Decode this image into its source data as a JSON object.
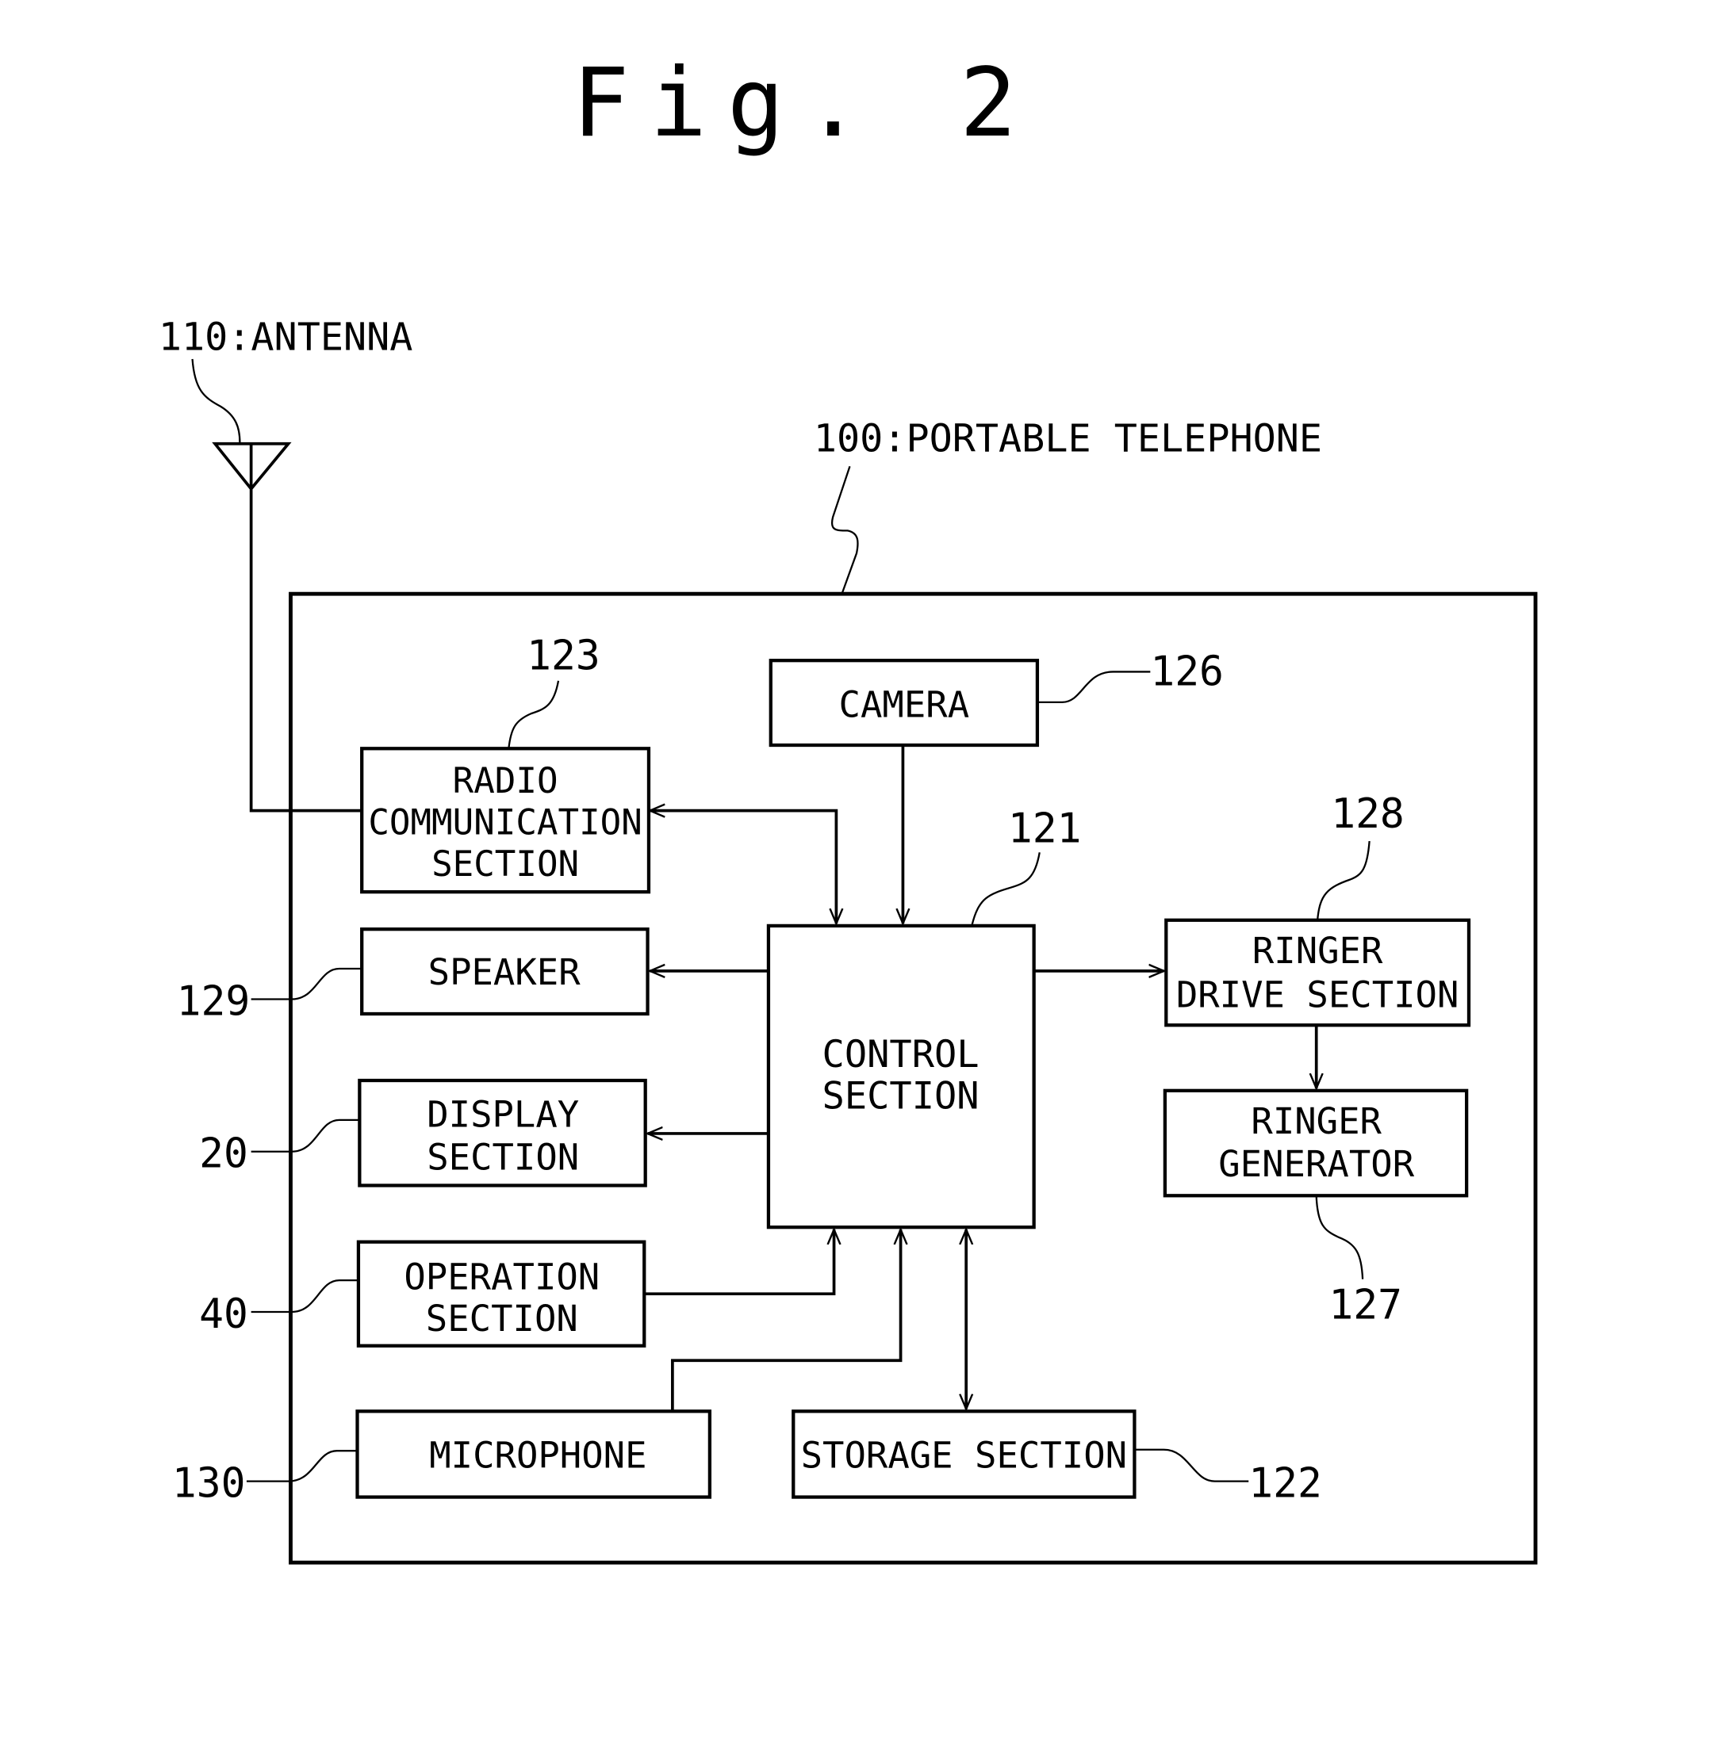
{
  "figure": {
    "title": "Fig. 2"
  },
  "labels": {
    "antenna": "110:ANTENNA",
    "device": "100:PORTABLE TELEPHONE"
  },
  "blocks": {
    "camera": {
      "lines": [
        "CAMERA"
      ],
      "ref": "126"
    },
    "radio": {
      "lines": [
        "RADIO",
        "COMMUNICATION",
        "SECTION"
      ],
      "ref": "123"
    },
    "control": {
      "lines": [
        "CONTROL",
        "SECTION"
      ],
      "ref": "121"
    },
    "speaker": {
      "lines": [
        "SPEAKER"
      ],
      "ref": "129"
    },
    "display": {
      "lines": [
        "DISPLAY",
        "SECTION"
      ],
      "ref": "20"
    },
    "operation": {
      "lines": [
        "OPERATION",
        "SECTION"
      ],
      "ref": "40"
    },
    "microphone": {
      "lines": [
        "MICROPHONE"
      ],
      "ref": "130"
    },
    "storage": {
      "lines": [
        "STORAGE SECTION"
      ],
      "ref": "122"
    },
    "ringer_drive": {
      "lines": [
        "RINGER",
        "DRIVE SECTION"
      ],
      "ref": "128"
    },
    "ringer_generator": {
      "lines": [
        "RINGER",
        "GENERATOR"
      ],
      "ref": "127"
    }
  }
}
